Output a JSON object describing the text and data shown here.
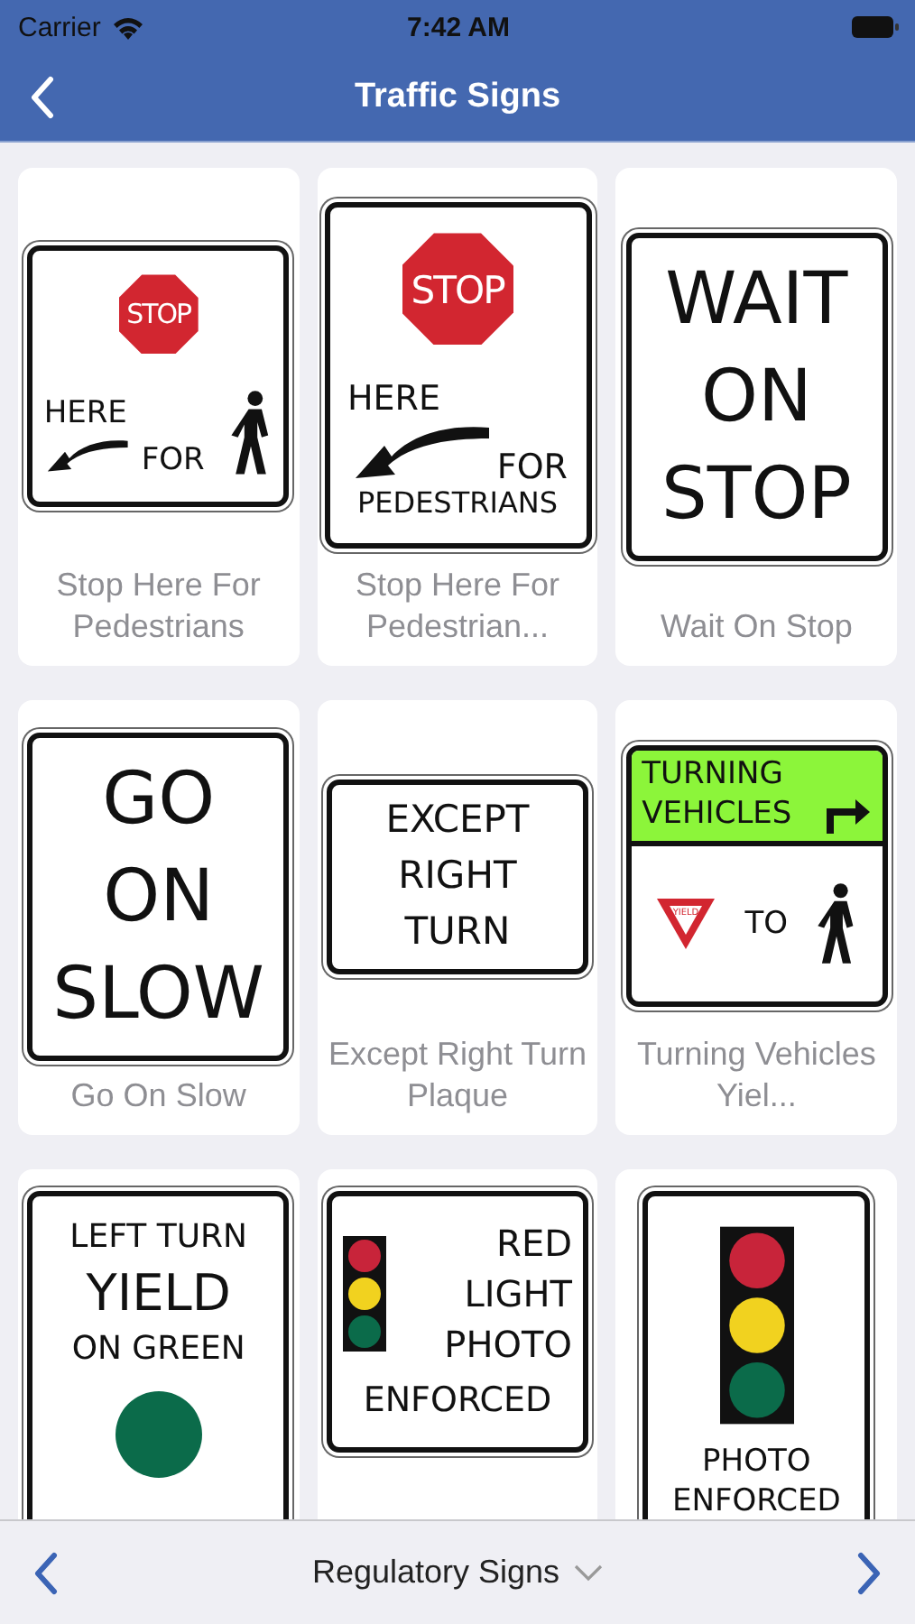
{
  "status_bar": {
    "carrier": "Carrier",
    "time": "7:42 AM"
  },
  "nav": {
    "title": "Traffic Signs"
  },
  "signs": [
    {
      "caption": "Stop Here For Pedestrians",
      "sign": {
        "kind": "stop_here",
        "plate": "STOP",
        "lines": [
          "HERE",
          "FOR"
        ],
        "figure": true
      }
    },
    {
      "caption": "Stop Here For Pedestrian...",
      "sign": {
        "kind": "stop_here",
        "plate": "STOP",
        "lines": [
          "HERE",
          "FOR",
          "PEDESTRIANS"
        ],
        "figure": false
      }
    },
    {
      "caption": "Wait On Stop",
      "sign": {
        "kind": "tall_text",
        "lines": [
          "WAIT",
          "ON",
          "STOP"
        ]
      }
    },
    {
      "caption": "Go On Slow",
      "sign": {
        "kind": "tall_text",
        "lines": [
          "GO",
          "ON",
          "SLOW"
        ]
      }
    },
    {
      "caption": "Except Right Turn Plaque",
      "sign": {
        "kind": "plaque",
        "lines": [
          "EXCEPT",
          "RIGHT",
          "TURN"
        ]
      }
    },
    {
      "caption": "Turning Vehicles Yiel...",
      "sign": {
        "kind": "turning_vehicles",
        "header": [
          "TURNING",
          "VEHICLES"
        ],
        "plate": "YIELD",
        "lines": [
          "TO"
        ]
      }
    },
    {
      "sign": {
        "kind": "yield_on_green",
        "lines": [
          "LEFT TURN",
          "YIELD",
          "ON GREEN"
        ]
      }
    },
    {
      "sign": {
        "kind": "red_light",
        "lines": [
          "RED",
          "LIGHT",
          "PHOTO",
          "ENFORCED"
        ]
      }
    },
    {
      "sign": {
        "kind": "photo_enforced",
        "lines": [
          "PHOTO",
          "ENFORCED"
        ]
      }
    }
  ],
  "footer": {
    "category": "Regulatory Signs"
  }
}
